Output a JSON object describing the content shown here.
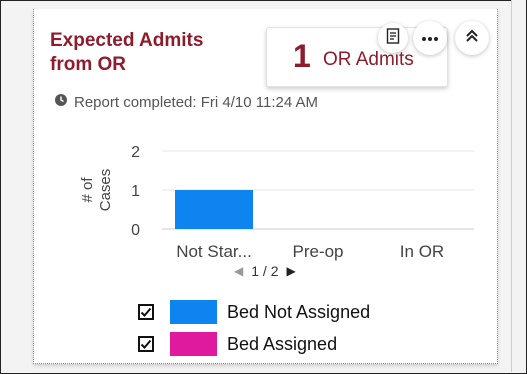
{
  "card": {
    "title": "Expected Admits from OR",
    "metric_value": "1",
    "metric_label": "OR Admits",
    "status_text": "Report completed: Fri 4/10 11:24 AM"
  },
  "icons": {
    "report": "report-icon",
    "more": "more-horizontal-icon",
    "collapse": "chevron-up-double-icon",
    "clock": "clock-icon",
    "checkbox": "check-icon"
  },
  "pager": {
    "text": "1 / 2"
  },
  "legend": [
    {
      "label": "Bed Not Assigned",
      "color": "#0d84f0",
      "checked": true
    },
    {
      "label": "Bed Assigned",
      "color": "#e01a9e",
      "checked": true
    }
  ],
  "chart_data": {
    "type": "bar",
    "categories": [
      "Not Star...",
      "Pre-op",
      "In OR"
    ],
    "series": [
      {
        "name": "Bed Not Assigned",
        "values": [
          1,
          0,
          0
        ],
        "color": "#0d84f0"
      },
      {
        "name": "Bed Assigned",
        "values": [
          0,
          0,
          0
        ],
        "color": "#e01a9e"
      }
    ],
    "ylabel": "# of Cases",
    "ylim": [
      0,
      2
    ],
    "yticks": [
      0,
      1,
      2
    ],
    "grid": true,
    "legend_placement": "bottom"
  }
}
